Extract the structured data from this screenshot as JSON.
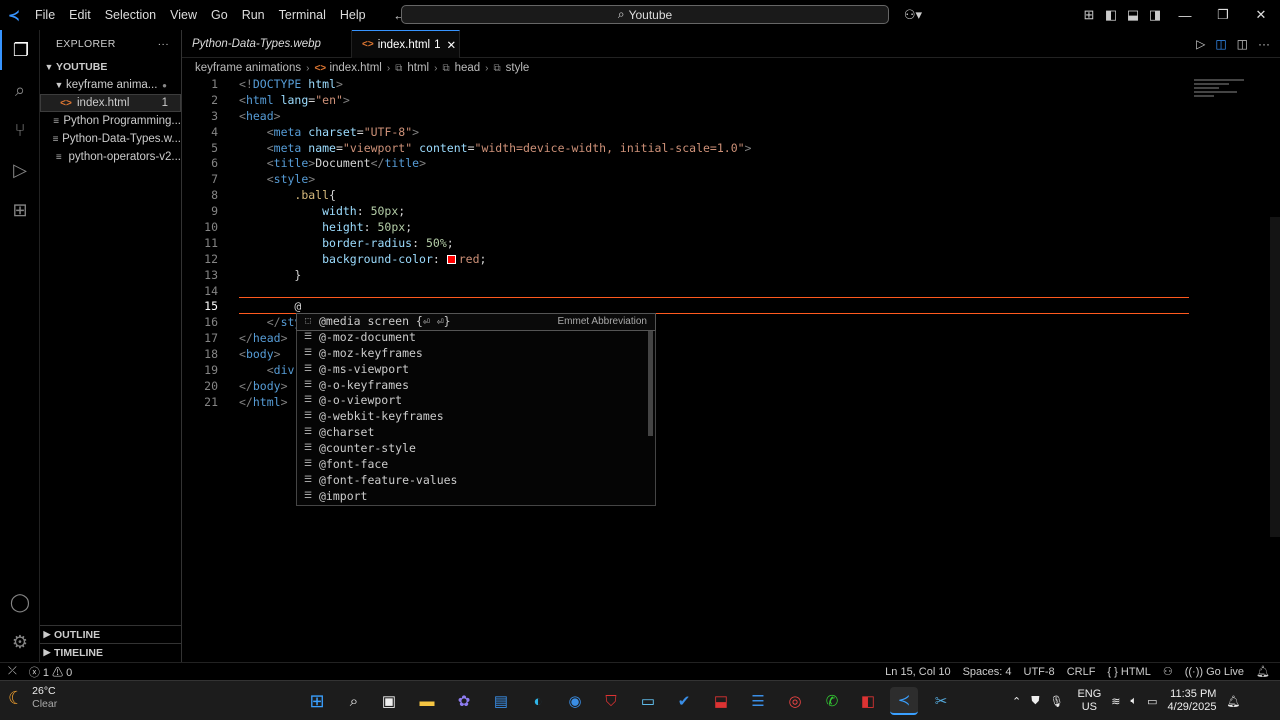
{
  "titlebar": {
    "menu": [
      "File",
      "Edit",
      "Selection",
      "View",
      "Go",
      "Run",
      "Terminal",
      "Help"
    ],
    "search_text": "Youtube"
  },
  "explorer": {
    "title": "EXPLORER",
    "workspace": "YOUTUBE",
    "folder": "keyframe anima...",
    "files": [
      {
        "name": "index.html",
        "badge": "1"
      },
      {
        "name": "Python Programming...",
        "badge": ""
      },
      {
        "name": "Python-Data-Types.w...",
        "badge": ""
      },
      {
        "name": "python-operators-v2...",
        "badge": ""
      }
    ],
    "outline": "OUTLINE",
    "timeline": "TIMELINE"
  },
  "tabs": [
    {
      "label": "Python-Data-Types.webp",
      "active": false
    },
    {
      "label": "index.html",
      "badge": "1",
      "active": true
    }
  ],
  "breadcrumb": [
    "keyframe animations",
    "index.html",
    "html",
    "head",
    "style"
  ],
  "editor": {
    "line_numbers": [
      "1",
      "2",
      "3",
      "4",
      "5",
      "6",
      "7",
      "8",
      "9",
      "10",
      "11",
      "12",
      "13",
      "14",
      "15",
      "16",
      "17",
      "18",
      "19",
      "20",
      "21"
    ],
    "current_line": "15"
  },
  "suggest": {
    "items": [
      {
        "label": "@media screen {⏎  ⏎}",
        "detail": "Emmet Abbreviation"
      },
      {
        "label": "@-moz-document"
      },
      {
        "label": "@-moz-keyframes"
      },
      {
        "label": "@-ms-viewport"
      },
      {
        "label": "@-o-keyframes"
      },
      {
        "label": "@-o-viewport"
      },
      {
        "label": "@-webkit-keyframes"
      },
      {
        "label": "@charset"
      },
      {
        "label": "@counter-style"
      },
      {
        "label": "@font-face"
      },
      {
        "label": "@font-feature-values"
      },
      {
        "label": "@import"
      }
    ]
  },
  "statusbar": {
    "errors": "1",
    "warnings": "0",
    "position": "Ln 15, Col 10",
    "spaces": "Spaces: 4",
    "encoding": "UTF-8",
    "eol": "CRLF",
    "language": "HTML",
    "golive": "Go Live"
  },
  "taskbar": {
    "temp": "26°C",
    "weather": "Clear",
    "lang1": "ENG",
    "lang2": "US",
    "time": "11:35 PM",
    "date": "4/29/2025"
  },
  "colors": {
    "accent": "#3794ff",
    "current_line_border": "#ff5a1f"
  }
}
